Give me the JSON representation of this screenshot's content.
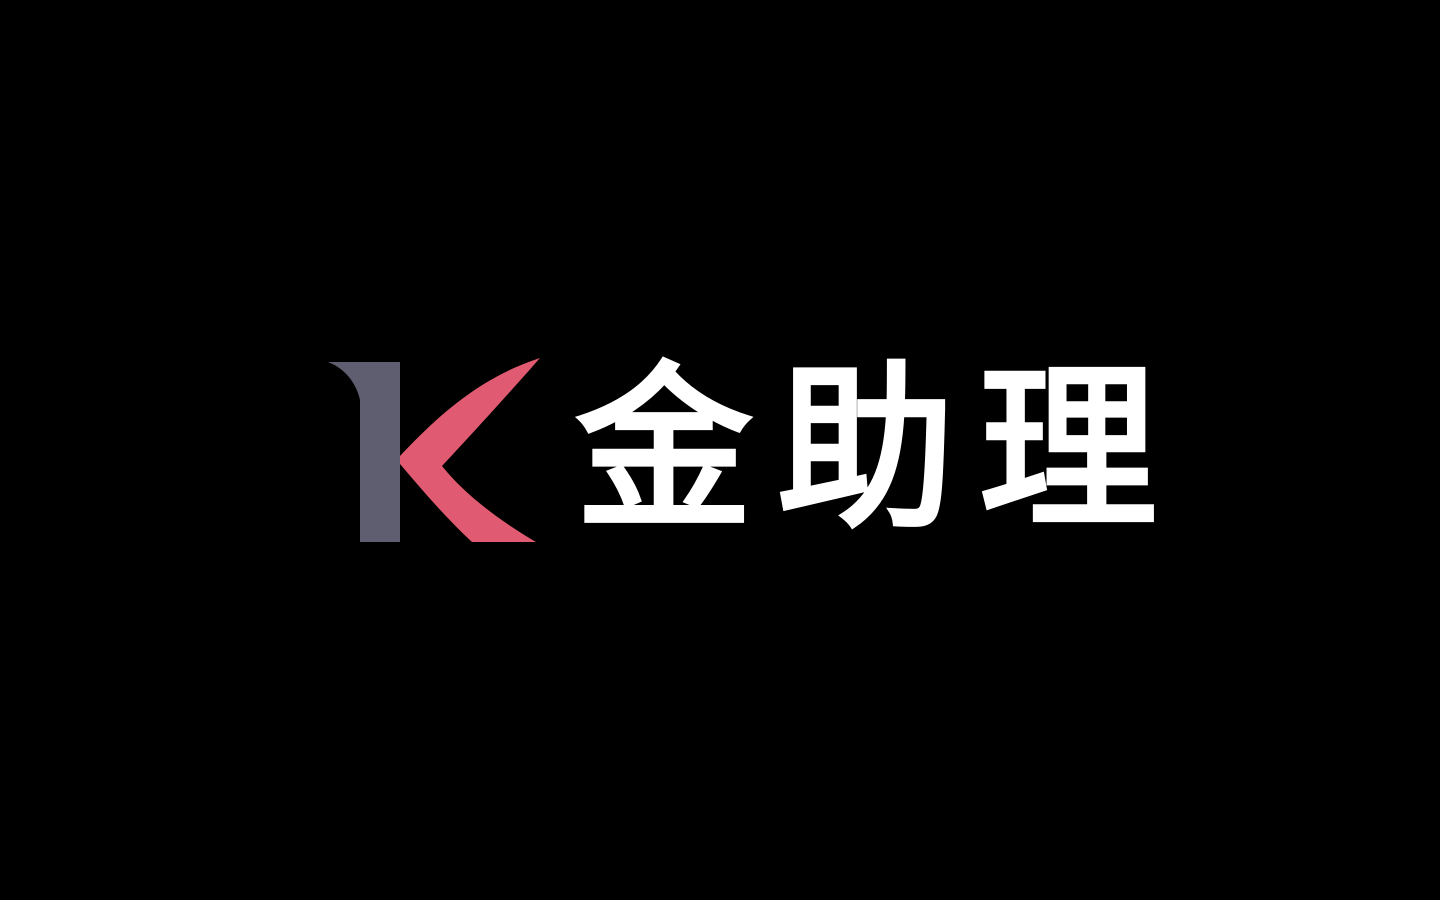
{
  "brand": {
    "name": "K金助理",
    "mark_letter": "K",
    "wordmark_chars": [
      "金",
      "助",
      "理"
    ]
  },
  "colors": {
    "background": "#000000",
    "mark_stem": "#5f5d70",
    "mark_arm": "#e05a72",
    "wordmark": "#ffffff"
  }
}
